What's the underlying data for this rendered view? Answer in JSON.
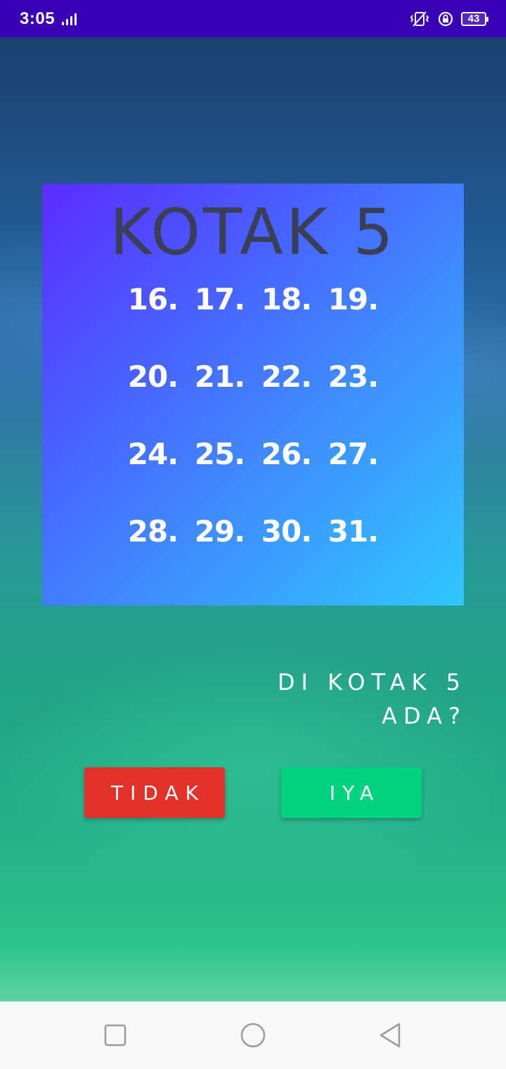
{
  "status_bar": {
    "time": "3:05",
    "battery": "43",
    "icons": [
      "signal-icon",
      "vibrate-icon",
      "rotation-lock-icon",
      "battery-icon"
    ]
  },
  "card": {
    "title": "KOTAK 5",
    "numbers": [
      [
        "16.",
        "17.",
        "18.",
        "19."
      ],
      [
        "20.",
        "21.",
        "22.",
        "23."
      ],
      [
        "24.",
        "25.",
        "26.",
        "27."
      ],
      [
        "28.",
        "29.",
        "30.",
        "31."
      ]
    ]
  },
  "question": {
    "line1": "DI KOTAK 5",
    "line2": "ADA?"
  },
  "buttons": {
    "tidak": "TIDAK",
    "iya": "IYA"
  },
  "colors": {
    "status_bar": "#3a00b5",
    "tidak": "#e2312b",
    "iya": "#00d37f",
    "title": "#3b3f55"
  },
  "nav": {
    "icons": [
      "recents-icon",
      "home-icon",
      "back-icon"
    ]
  }
}
